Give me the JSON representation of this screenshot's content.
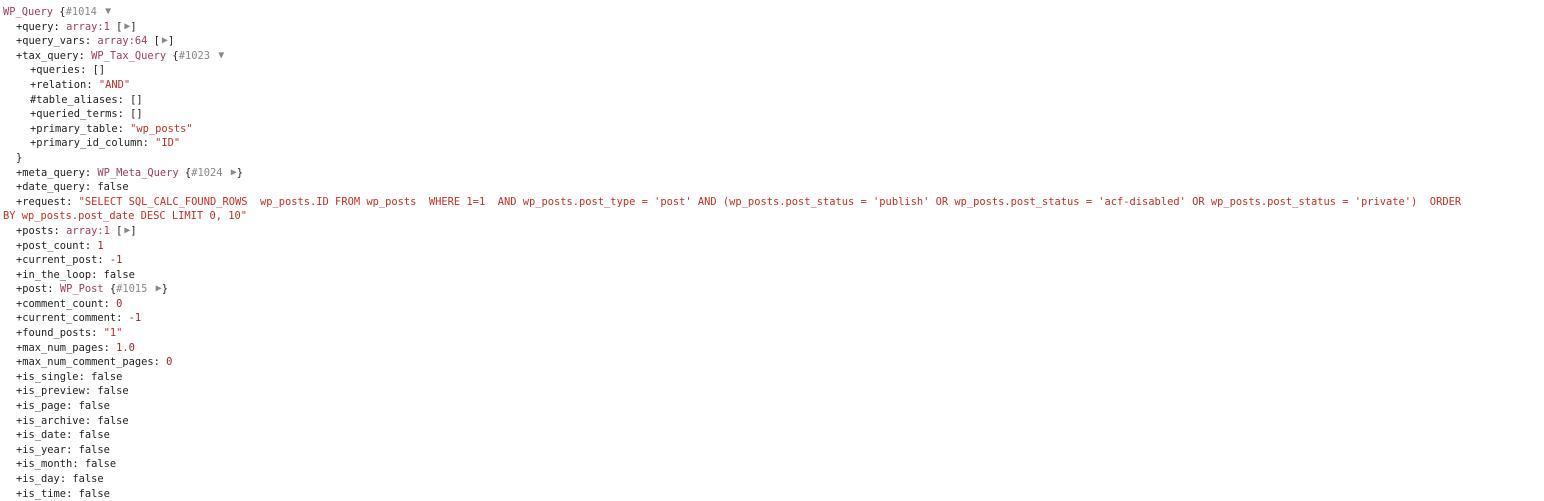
{
  "root": {
    "class": "WP_Query",
    "ref": "#1014",
    "open_glyph": "▼",
    "close_glyph": "▶"
  },
  "query": {
    "key": "query",
    "type": "array:1"
  },
  "query_vars": {
    "key": "query_vars",
    "type": "array:64"
  },
  "tax_query": {
    "key": "tax_query",
    "class": "WP_Tax_Query",
    "ref": "#1023",
    "children": [
      {
        "prefix": "+",
        "key": "queries",
        "value": "[]"
      },
      {
        "prefix": "+",
        "key": "relation",
        "value": "\"AND\""
      },
      {
        "prefix": "#",
        "key": "table_aliases",
        "value": "[]"
      },
      {
        "prefix": "+",
        "key": "queried_terms",
        "value": "[]"
      },
      {
        "prefix": "+",
        "key": "primary_table",
        "value": "\"wp_posts\""
      },
      {
        "prefix": "+",
        "key": "primary_id_column",
        "value": "\"ID\""
      }
    ],
    "close": "}"
  },
  "meta_query": {
    "key": "meta_query",
    "class": "WP_Meta_Query",
    "ref": "#1024",
    "close": "}"
  },
  "date_query": {
    "key": "date_query",
    "value": "false"
  },
  "request": {
    "key": "request",
    "line1": "\"SELECT SQL_CALC_FOUND_ROWS  wp_posts.ID FROM wp_posts  WHERE 1=1  AND wp_posts.post_type = 'post' AND (wp_posts.post_status = 'publish' OR wp_posts.post_status = 'acf-disabled' OR wp_posts.post_status = 'private')  ORDER",
    "line2": "BY wp_posts.post_date DESC LIMIT 0, 10\""
  },
  "posts": {
    "key": "posts",
    "type": "array:1"
  },
  "post": {
    "key": "post",
    "class": "WP_Post",
    "ref": "#1015",
    "close": "}"
  },
  "props": [
    {
      "key": "post_count",
      "value": "1"
    },
    {
      "key": "current_post",
      "value": "-1"
    },
    {
      "key": "in_the_loop",
      "value": "false"
    },
    {
      "key": "comment_count",
      "value": "0"
    },
    {
      "key": "current_comment",
      "value": "-1"
    },
    {
      "key": "found_posts",
      "value": "\"1\""
    },
    {
      "key": "max_num_pages",
      "value": "1.0"
    },
    {
      "key": "max_num_comment_pages",
      "value": "0"
    },
    {
      "key": "is_single",
      "value": "false"
    },
    {
      "key": "is_preview",
      "value": "false"
    },
    {
      "key": "is_page",
      "value": "false"
    },
    {
      "key": "is_archive",
      "value": "false"
    },
    {
      "key": "is_date",
      "value": "false"
    },
    {
      "key": "is_year",
      "value": "false"
    },
    {
      "key": "is_month",
      "value": "false"
    },
    {
      "key": "is_day",
      "value": "false"
    },
    {
      "key": "is_time",
      "value": "false"
    }
  ],
  "colors": {
    "class": "#a03c5f",
    "number": "#9a2626",
    "string": "#c62f22",
    "ref": "#888888"
  }
}
